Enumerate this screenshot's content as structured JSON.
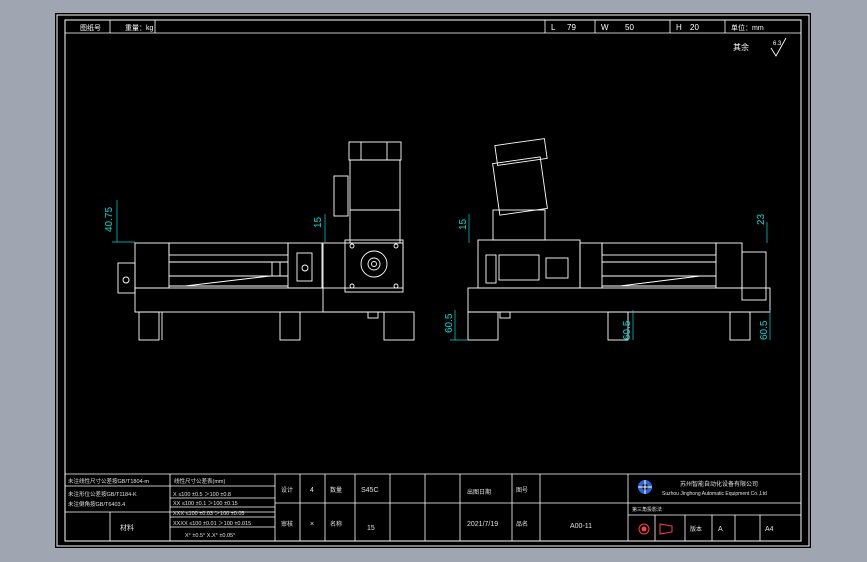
{
  "colors": {
    "background": "#a0a6b1",
    "sheet": "#000000",
    "lines": "#ffffff",
    "dims": "#00d8d8",
    "logo": "#2a64d8"
  },
  "header": {
    "left_label_1": "图纸号",
    "left_label_2": "重量：kg",
    "L_label": "L",
    "L_value": "79",
    "W_label": "W",
    "W_value": "50",
    "H_label": "H",
    "H_value": "20",
    "unit_label": "单位：mm",
    "roughness_label": "其余",
    "roughness_symbol": "6.3"
  },
  "dimensions": {
    "d1": "40.75",
    "d2": "15",
    "d3": "15",
    "d4": "23",
    "d5": "60.5",
    "d6": "60.5",
    "d7": "60.5"
  },
  "title_block": {
    "notes_1": "未注线性尺寸公差按GB/T1804-m",
    "notes_2": "未注形位公差按GB/T1184-K",
    "notes_3": "未注倒角按GB/T6403.4",
    "tol_header": "线性尺寸公差表(mm)",
    "tol_rows": [
      "X    ≤100 ±0.5  ＞100 ±0.8",
      "XX   ≤100 ±0.1  ＞100 ±0.15",
      "XXX  ≤100 ±0.03 ＞100 ±0.05",
      "XXXX ≤100 ±0.01 ＞100 ±0.015"
    ],
    "tol_angle": "X° ±0.5°   X.X° ±0.05°",
    "material_label": "材料",
    "col_a": "设计",
    "col_b": "审核",
    "qty_label": "数量",
    "qty_value": "4",
    "name_label": "名称",
    "name_value": "S45C",
    "scale_value": "15",
    "x_mark": "×",
    "date_label": "出图日期",
    "date_value": "2021/7/19",
    "drawing_no_label": "图号",
    "drawing_no_value": "A00-11",
    "part_label": "品名",
    "company_cn": "苏州智能自动化设备有限公司",
    "company_en": "Suzhou Jinghong Automatic Equipment Co.,Ltd",
    "third_angle": "第三角投影法",
    "version_label": "版本",
    "version_value": "A",
    "size_value": "A4"
  }
}
